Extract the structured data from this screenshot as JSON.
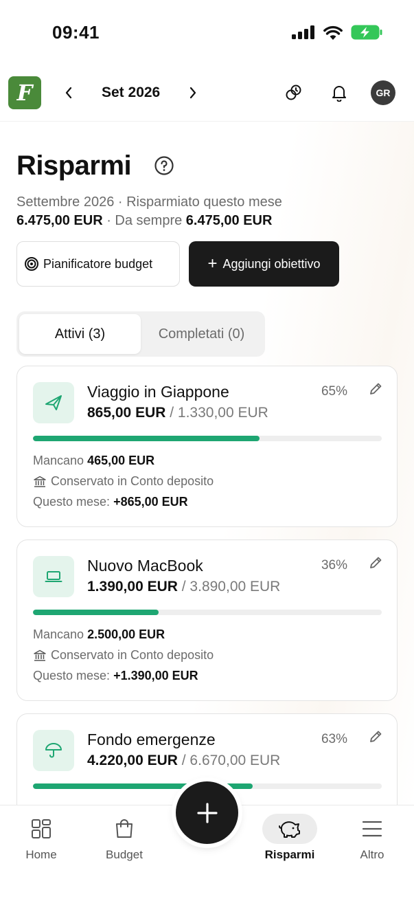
{
  "status_bar": {
    "time": "09:41"
  },
  "header": {
    "logo_letter": "F",
    "month": "Set 2026",
    "avatar_initials": "GR"
  },
  "page": {
    "title": "Risparmi",
    "summary_line1": "Settembre 2026 · Risparmiato questo mese",
    "month_saved": "6.475,00 EUR",
    "separator": "· Da sempre",
    "total_saved": "6.475,00 EUR"
  },
  "actions": {
    "planner_label": "Pianificatore budget",
    "add_goal_label": "Aggiungi obiettivo"
  },
  "tabs": {
    "active_label": "Attivi (3)",
    "completed_label": "Completati (0)"
  },
  "goals": [
    {
      "icon": "plane-icon",
      "name": "Viaggio in Giappone",
      "saved": "865,00 EUR",
      "target": "/ 1.330,00 EUR",
      "percent": "65%",
      "progress": 0.65,
      "remaining_label": "Mancano",
      "remaining": "465,00 EUR",
      "stored_in": "Conservato in Conto deposito",
      "month_label": "Questo mese:",
      "month_change": "+865,00 EUR"
    },
    {
      "icon": "laptop-icon",
      "name": "Nuovo MacBook",
      "saved": "1.390,00 EUR",
      "target": "/ 3.890,00 EUR",
      "percent": "36%",
      "progress": 0.36,
      "remaining_label": "Mancano",
      "remaining": "2.500,00 EUR",
      "stored_in": "Conservato in Conto deposito",
      "month_label": "Questo mese:",
      "month_change": "+1.390,00 EUR"
    },
    {
      "icon": "umbrella-icon",
      "name": "Fondo emergenze",
      "saved": "4.220,00 EUR",
      "target": "/ 6.670,00 EUR",
      "percent": "63%",
      "progress": 0.63
    }
  ],
  "nav": {
    "home": "Home",
    "budget": "Budget",
    "savings": "Risparmi",
    "more": "Altro"
  },
  "colors": {
    "accent": "#1ea672",
    "accent_bg": "#e4f4ec",
    "dark": "#1b1b1b"
  }
}
